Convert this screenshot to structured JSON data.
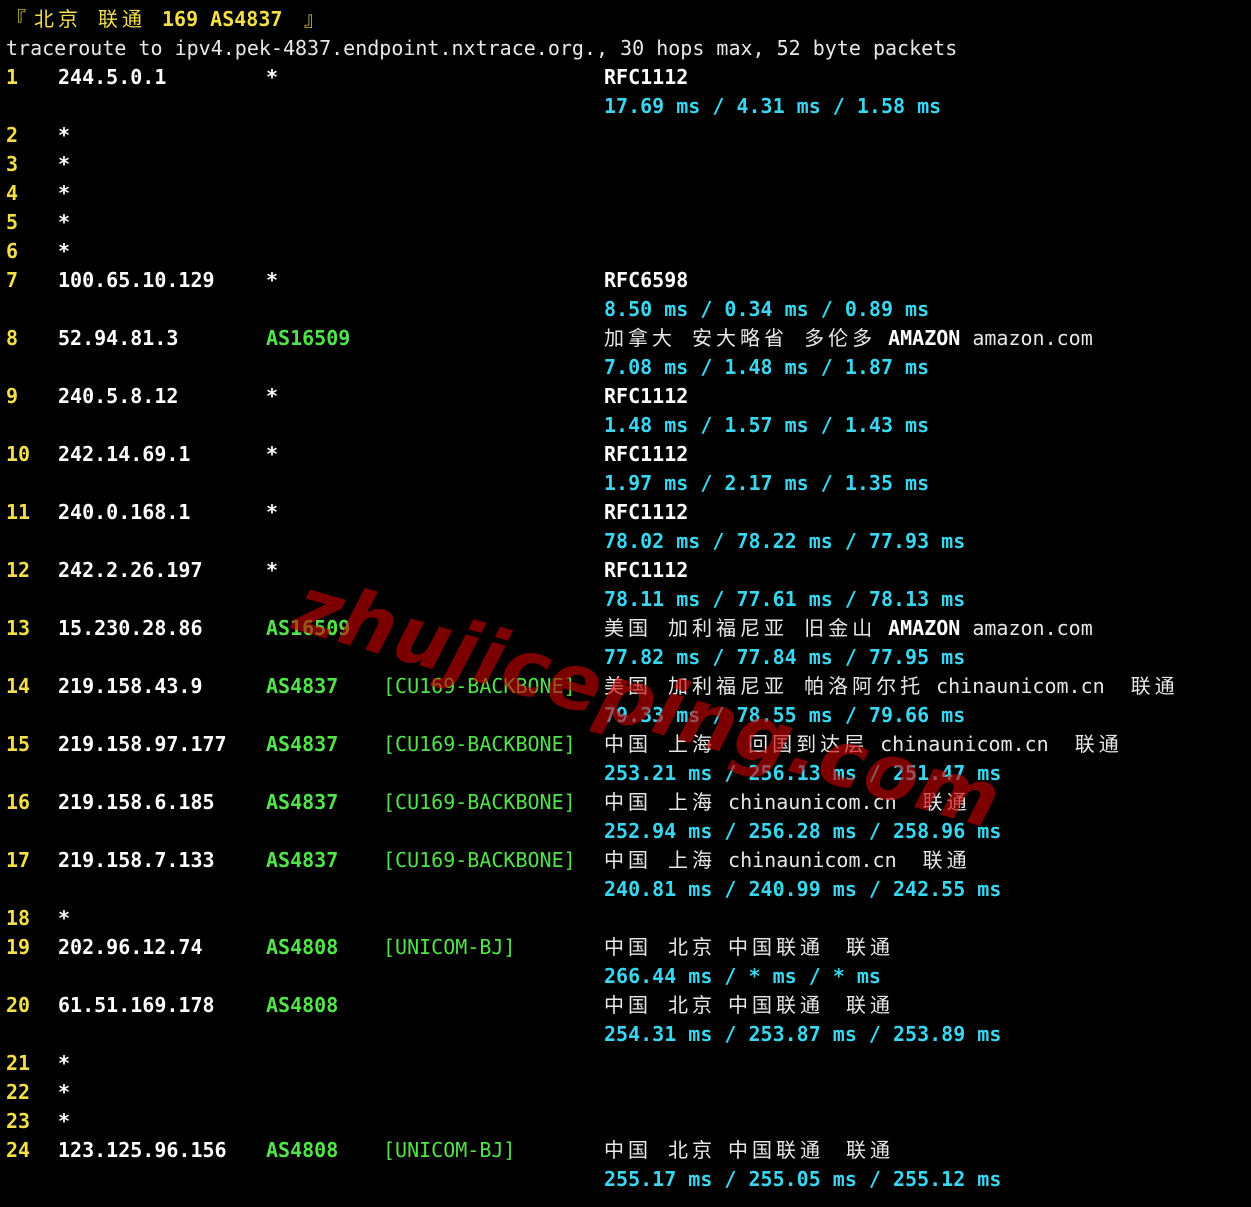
{
  "header": {
    "bracket_open": "『",
    "location": "北京 联通",
    "network": "169 AS4837",
    "bracket_close": "』",
    "command": "traceroute to ipv4.pek-4837.endpoint.nxtrace.org., 30 hops max, 52 byte packets"
  },
  "hops": [
    {
      "hop": "1",
      "ip": "244.5.0.1",
      "asn": "*",
      "tag": "",
      "geo": "",
      "rfc": "RFC1112",
      "rtt": "17.69 ms / 4.31 ms / 1.58 ms"
    },
    {
      "hop": "2",
      "ip": "*"
    },
    {
      "hop": "3",
      "ip": "*"
    },
    {
      "hop": "4",
      "ip": "*"
    },
    {
      "hop": "5",
      "ip": "*"
    },
    {
      "hop": "6",
      "ip": "*"
    },
    {
      "hop": "7",
      "ip": "100.65.10.129",
      "asn": "*",
      "tag": "",
      "geo": "",
      "rfc": "RFC6598",
      "rtt": "8.50 ms / 0.34 ms / 0.89 ms"
    },
    {
      "hop": "8",
      "ip": "52.94.81.3",
      "asn": "AS16509",
      "tag": "",
      "geo": "加拿大 安大略省 多伦多",
      "org": "AMAZON",
      "domain": "amazon.com",
      "rtt": "7.08 ms / 1.48 ms / 1.87 ms"
    },
    {
      "hop": "9",
      "ip": "240.5.8.12",
      "asn": "*",
      "tag": "",
      "geo": "",
      "rfc": "RFC1112",
      "rtt": "1.48 ms / 1.57 ms / 1.43 ms"
    },
    {
      "hop": "10",
      "ip": "242.14.69.1",
      "asn": "*",
      "tag": "",
      "geo": "",
      "rfc": "RFC1112",
      "rtt": "1.97 ms / 2.17 ms / 1.35 ms"
    },
    {
      "hop": "11",
      "ip": "240.0.168.1",
      "asn": "*",
      "tag": "",
      "geo": "",
      "rfc": "RFC1112",
      "rtt": "78.02 ms / 78.22 ms / 77.93 ms"
    },
    {
      "hop": "12",
      "ip": "242.2.26.197",
      "asn": "*",
      "tag": "",
      "geo": "",
      "rfc": "RFC1112",
      "rtt": "78.11 ms / 77.61 ms / 78.13 ms"
    },
    {
      "hop": "13",
      "ip": "15.230.28.86",
      "asn": "AS16509",
      "tag": "",
      "geo": "美国 加利福尼亚 旧金山",
      "org": "AMAZON",
      "domain": "amazon.com",
      "rtt": "77.82 ms / 77.84 ms / 77.95 ms"
    },
    {
      "hop": "14",
      "ip": "219.158.43.9",
      "asn": "AS4837",
      "tag": "[CU169-BACKBONE]",
      "geo": "美国 加利福尼亚 帕洛阿尔托",
      "domain": "chinaunicom.cn",
      "isp": "联通",
      "rtt": "79.33 ms / 78.55 ms / 79.66 ms"
    },
    {
      "hop": "15",
      "ip": "219.158.97.177",
      "asn": "AS4837",
      "tag": "[CU169-BACKBONE]",
      "geo": "中国 上海  回国到达层",
      "domain": "chinaunicom.cn",
      "isp": "联通",
      "rtt": "253.21 ms / 256.13 ms / 251.47 ms"
    },
    {
      "hop": "16",
      "ip": "219.158.6.185",
      "asn": "AS4837",
      "tag": "[CU169-BACKBONE]",
      "geo": "中国 上海",
      "domain": "chinaunicom.cn",
      "isp": "联通",
      "rtt": "252.94 ms / 256.28 ms / 258.96 ms"
    },
    {
      "hop": "17",
      "ip": "219.158.7.133",
      "asn": "AS4837",
      "tag": "[CU169-BACKBONE]",
      "geo": "中国 上海",
      "domain": "chinaunicom.cn",
      "isp": "联通",
      "rtt": "240.81 ms / 240.99 ms / 242.55 ms"
    },
    {
      "hop": "18",
      "ip": "*"
    },
    {
      "hop": "19",
      "ip": "202.96.12.74",
      "asn": "AS4808",
      "tag": "[UNICOM-BJ]",
      "geo": "中国 北京",
      "org2": "中国联通",
      "isp": "联通",
      "rtt": "266.44 ms / * ms / * ms"
    },
    {
      "hop": "20",
      "ip": "61.51.169.178",
      "asn": "AS4808",
      "tag": "",
      "geo": "中国 北京",
      "org2": "中国联通",
      "isp": "联通",
      "rtt": "254.31 ms / 253.87 ms / 253.89 ms"
    },
    {
      "hop": "21",
      "ip": "*"
    },
    {
      "hop": "22",
      "ip": "*"
    },
    {
      "hop": "23",
      "ip": "*"
    },
    {
      "hop": "24",
      "ip": "123.125.96.156",
      "asn": "AS4808",
      "tag": "[UNICOM-BJ]",
      "geo": "中国 北京",
      "org2": "中国联通",
      "isp": "联通",
      "rtt": "255.17 ms / 255.05 ms / 255.12 ms"
    }
  ],
  "watermark": "zhujiceping.com",
  "colors": {
    "background": "#000000",
    "hop_number": "#f3df4a",
    "asn": "#52e34a",
    "rtt": "#3ad6f0",
    "ip": "#ffffff"
  }
}
